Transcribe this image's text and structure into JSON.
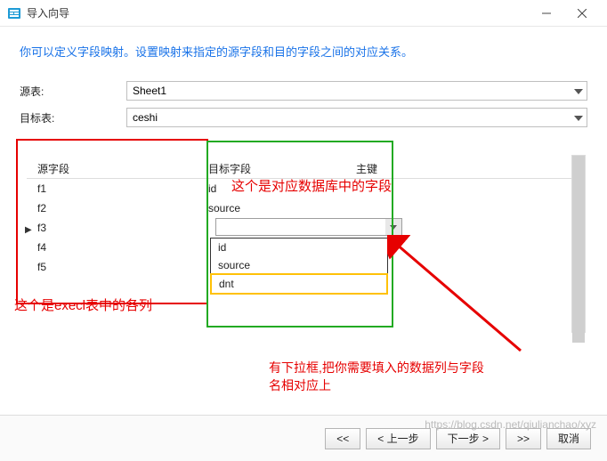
{
  "titlebar": {
    "title": "导入向导"
  },
  "description": "你可以定义字段映射。设置映射来指定的源字段和目的字段之间的对应关系。",
  "form": {
    "source_table_label": "源表:",
    "source_table_value": "Sheet1",
    "target_table_label": "目标表:",
    "target_table_value": "ceshi"
  },
  "grid": {
    "headers": {
      "src": "源字段",
      "tgt": "目标字段",
      "pk": "主键"
    },
    "rows": [
      {
        "src": "f1",
        "tgt": "id"
      },
      {
        "src": "f2",
        "tgt": "source"
      },
      {
        "src": "f3",
        "tgt": ""
      },
      {
        "src": "f4",
        "tgt": ""
      },
      {
        "src": "f5",
        "tgt": ""
      }
    ]
  },
  "combo": {
    "options": [
      "id",
      "source",
      "dnt"
    ]
  },
  "annotations": {
    "green_text": "这个是对应数据库中的字段",
    "left_text": "这个是execl表中的各列",
    "bottom_text_l1": "有下拉框,把你需要填入的数据列与字段",
    "bottom_text_l2": "名相对应上"
  },
  "footer": {
    "first": "<<",
    "prev": "< 上一步",
    "next": "下一步 >",
    "last": ">>",
    "cancel": "取消"
  },
  "watermark": "https://blog.csdn.net/qiulianchao/xyz"
}
